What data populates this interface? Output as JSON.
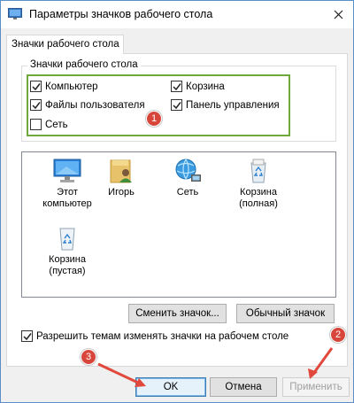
{
  "window": {
    "title": "Параметры значков рабочего стола"
  },
  "tab": {
    "label": "Значки рабочего стола"
  },
  "group": {
    "label": "Значки рабочего стола",
    "checkboxes": [
      {
        "label": "Компьютер",
        "checked": true
      },
      {
        "label": "Корзина",
        "checked": true
      },
      {
        "label": "Файлы пользователя",
        "checked": true
      },
      {
        "label": "Панель управления",
        "checked": true
      },
      {
        "label": "Сеть",
        "checked": false
      }
    ]
  },
  "icons": [
    {
      "label": "Этот компьютер",
      "icon": "computer-icon",
      "selected": true
    },
    {
      "label": "Игорь",
      "icon": "user-folder-icon",
      "selected": false
    },
    {
      "label": "Сеть",
      "icon": "network-icon",
      "selected": false
    },
    {
      "label": "Корзина (полная)",
      "icon": "recycle-bin-full-icon",
      "selected": false
    },
    {
      "label": "Корзина (пустая)",
      "icon": "recycle-bin-empty-icon",
      "selected": false
    }
  ],
  "buttons": {
    "change_icon": "Сменить значок...",
    "default_icon": "Обычный значок",
    "ok": "OK",
    "cancel": "Отмена",
    "apply": "Применить"
  },
  "allow_themes": {
    "label": "Разрешить темам изменять значки на рабочем столе",
    "checked": true
  },
  "annotations": {
    "badge1": "1",
    "badge2": "2",
    "badge3": "3"
  },
  "colors": {
    "highlight": "#6fa93b",
    "badge": "#d8453a",
    "arrow": "#e0493b",
    "window_border": "#5a8fc7"
  }
}
